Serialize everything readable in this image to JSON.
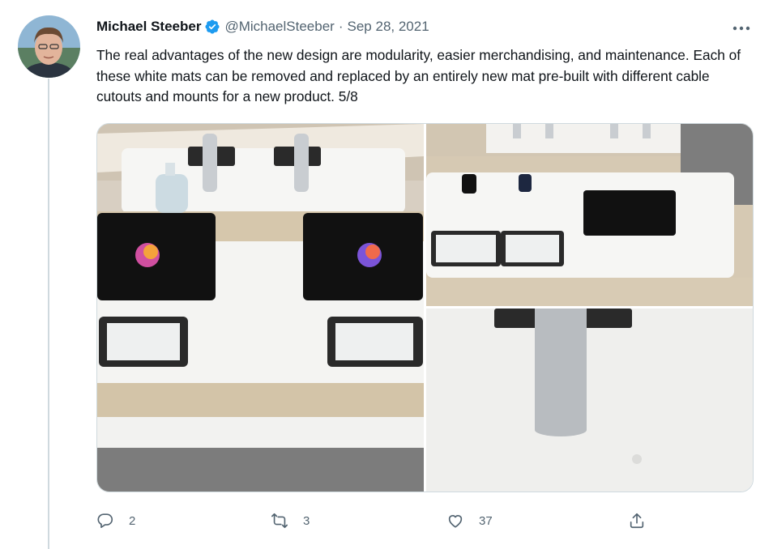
{
  "author": {
    "name": "Michael Steeber",
    "handle": "@MichaelSteeber",
    "separator": "·",
    "date": "Sep 28, 2021"
  },
  "tweet": {
    "text": "The real advantages of the new design are modularity, easier merchandising, and maintenance. Each of these white mats can be removed and replaced by an entirely new mat pre-built with different cable cutouts and mounts for a new product. 5/8"
  },
  "actions": {
    "reply_count": "2",
    "retweet_count": "3",
    "like_count": "37"
  },
  "icons": {
    "verified": "verified-badge-icon",
    "more": "more-dots-icon",
    "reply": "reply-icon",
    "retweet": "retweet-icon",
    "like": "heart-icon",
    "share": "share-icon"
  },
  "colors": {
    "verified": "#1d9bf0",
    "text": "#0f1419",
    "secondary": "#536471",
    "border": "#cfd9de"
  }
}
